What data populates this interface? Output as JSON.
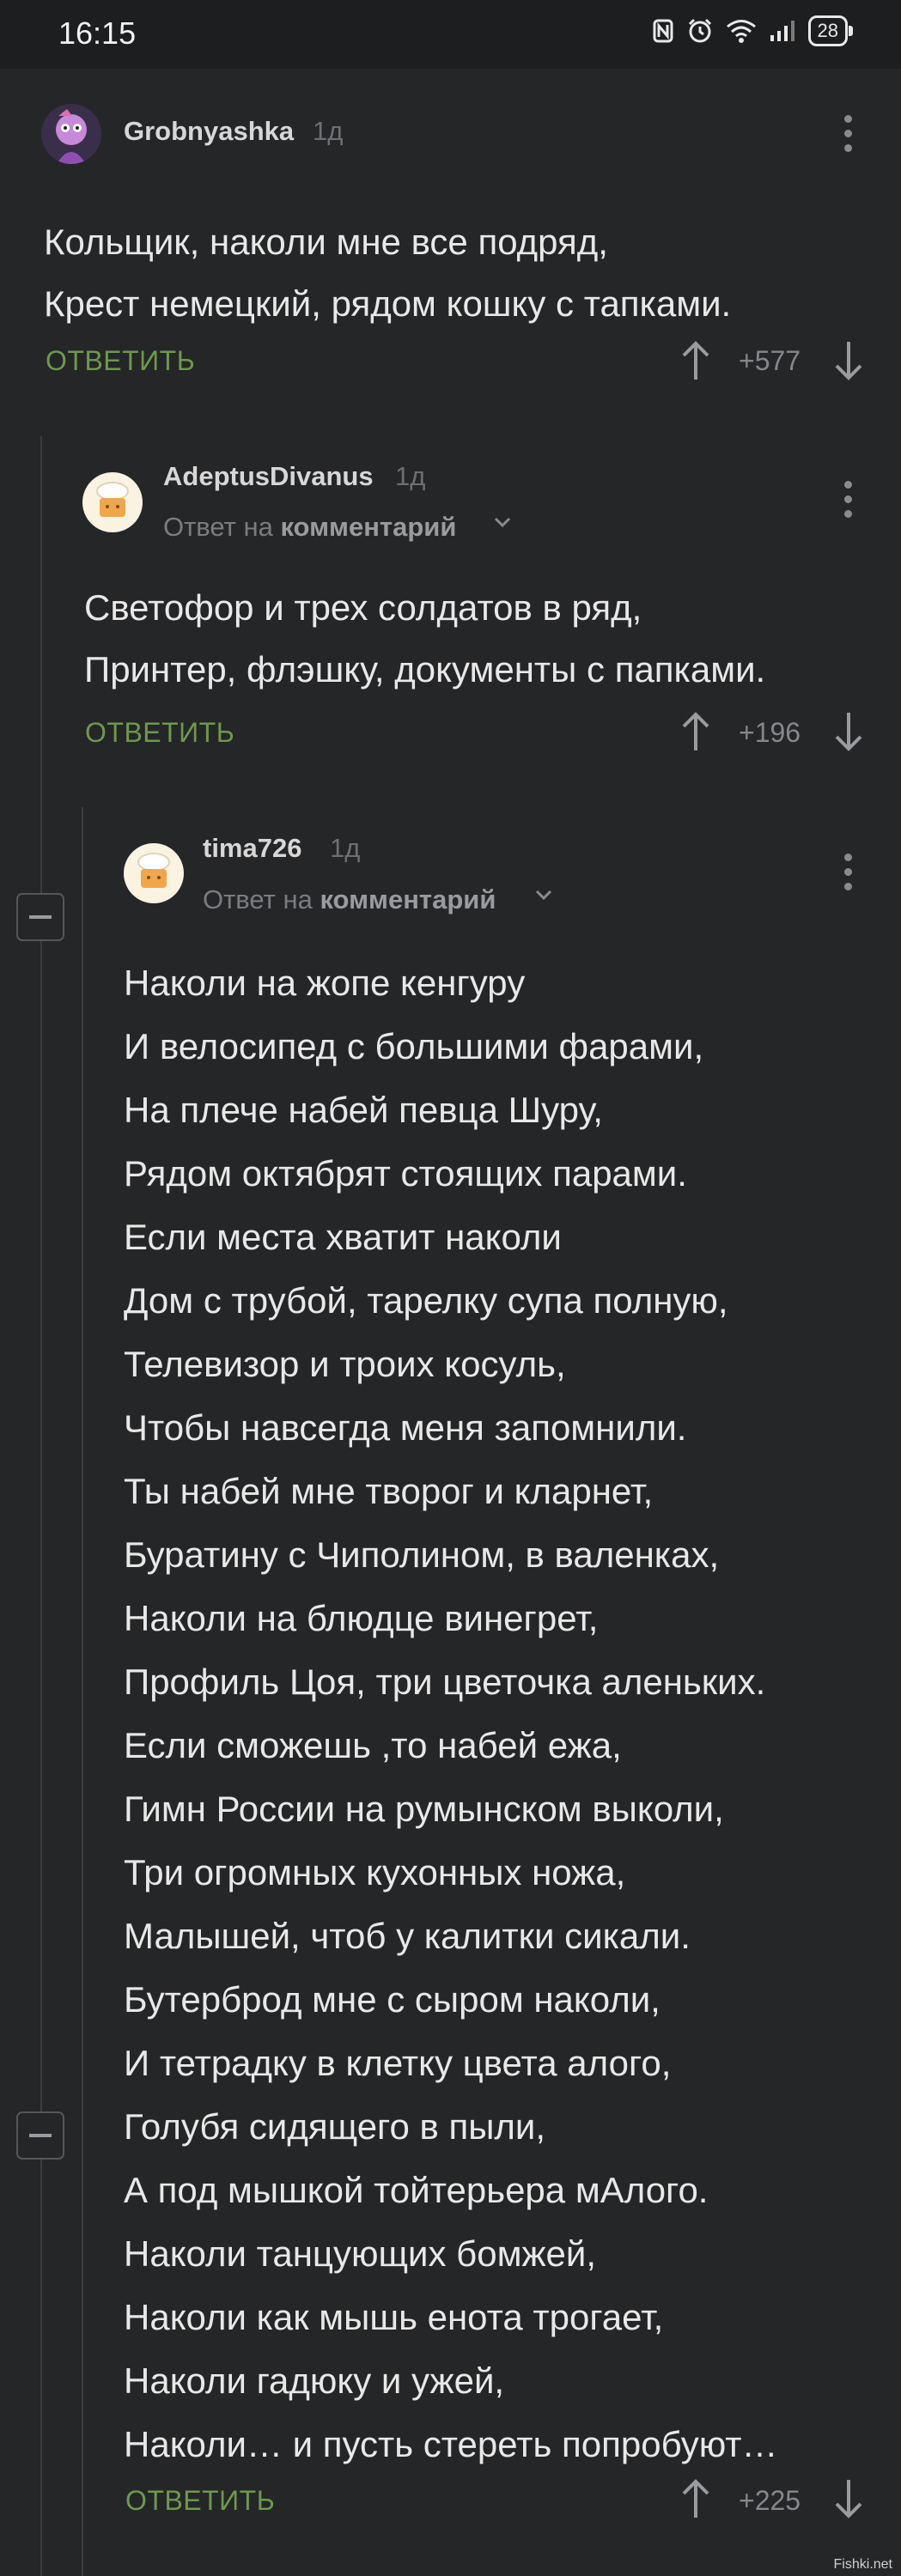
{
  "status_bar": {
    "time": "16:15",
    "battery": "28"
  },
  "comments": [
    {
      "user": "Grobnyashka",
      "ago": "1д",
      "lines": [
        "Кольщик, наколи мне все подряд,",
        "Крест немецкий, рядом кошку с тапками."
      ],
      "reply_label": "ОТВЕТИТЬ",
      "rating": "+577"
    },
    {
      "user": "AdeptusDivanus",
      "ago": "1д",
      "reply_prefix": "Ответ на",
      "reply_target": "комментарий",
      "lines": [
        "Светофор и трех солдатов в ряд,",
        "Принтер, флэшку, документы с папками."
      ],
      "reply_label": "ОТВЕТИТЬ",
      "rating": "+196"
    },
    {
      "user": "tima726",
      "ago": "1д",
      "reply_prefix": "Ответ на",
      "reply_target": "комментарий",
      "lines": [
        "Наколи на жопе кенгуру",
        "И велосипед с большими фарами,",
        "На плече набей певца Шуру,",
        "Рядом октябрят стоящих парами.",
        "Если места хватит наколи",
        "Дом с трубой, тарелку супа полную,",
        "Телевизор и троих косуль,",
        "Чтобы навсегда меня запомнили.",
        "Ты набей мне творог и кларнет,",
        "Буратину с Чиполином, в валенках,",
        "Наколи на блюдце винегрет,",
        "Профиль Цоя, три цветочка аленьких.",
        "Если сможешь ,то набей ежа,",
        "Гимн России на румынском выколи,",
        "Три огромных кухонных ножа,",
        "Малышей, чтоб у калитки сикали.",
        "Бутерброд мне с сыром наколи,",
        "И тетрадку в клетку цвета алого,",
        "Голубя сидящего в пыли,",
        "А под мышкой тойтерьера мАлого.",
        "Наколи танцующих бомжей,",
        "Наколи как мышь енота трогает,",
        "Наколи гадюку и ужей,",
        "Наколи… и пусть стереть попробуют…"
      ],
      "reply_label": "ОТВЕТИТЬ",
      "rating": "+225"
    }
  ],
  "watermark": "Fishki.net",
  "colors": {
    "background": "#252628",
    "reply_button": "#6c9a4a",
    "thread_line": "#3d3e42"
  },
  "icons": [
    "nfc-icon",
    "alarm-icon",
    "wifi-icon",
    "signal-icon",
    "battery-icon",
    "upvote-icon",
    "downvote-icon",
    "more-icon",
    "collapse-icon",
    "chevron-down-icon"
  ]
}
